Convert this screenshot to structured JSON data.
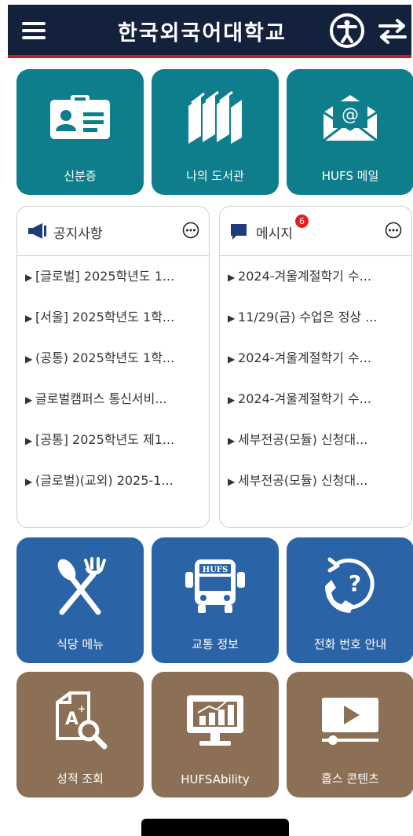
{
  "header": {
    "title": "한국외국어대학교"
  },
  "tiles_row1": [
    {
      "label": "신분증",
      "icon": "id-card-icon"
    },
    {
      "label": "나의 도서관",
      "icon": "books-icon"
    },
    {
      "label": "HUFS 메일",
      "icon": "mail-icon"
    }
  ],
  "notices": {
    "title": "공지사항",
    "items": [
      "[글로벌] 2025학년도 1...",
      "[서울] 2025학년도 1학...",
      "(공통) 2025학년도 1학...",
      "글로벌캠퍼스 통신서비...",
      "[공통] 2025학년도 제1...",
      "(글로벌)(교외) 2025-1..."
    ]
  },
  "messages": {
    "title": "메시지",
    "badge": "6",
    "items": [
      "2024-겨울계절학기 수...",
      "11/29(금) 수업은 정상 ...",
      "2024-겨울계절학기 수...",
      "2024-겨울계절학기 수...",
      "세부전공(모듈) 신청대...",
      "세부전공(모듈) 신청대..."
    ]
  },
  "tiles_row2": [
    {
      "label": "식당 메뉴",
      "icon": "fork-knife-icon"
    },
    {
      "label": "교통 정보",
      "icon": "bus-icon",
      "icon_text": "HUFS"
    },
    {
      "label": "전화 번호 안내",
      "icon": "phone-help-icon"
    }
  ],
  "tiles_row3": [
    {
      "label": "성적 조회",
      "icon": "grade-search-icon"
    },
    {
      "label": "HUFSAbility",
      "icon": "monitor-chart-icon"
    },
    {
      "label": "훕스 콘텐츠",
      "icon": "video-play-icon"
    }
  ],
  "colors": {
    "header": "#14213d",
    "accent_red": "#c81e2a",
    "teal": "#0e7e8c",
    "blue": "#2a63a6",
    "brown": "#8c7055"
  }
}
